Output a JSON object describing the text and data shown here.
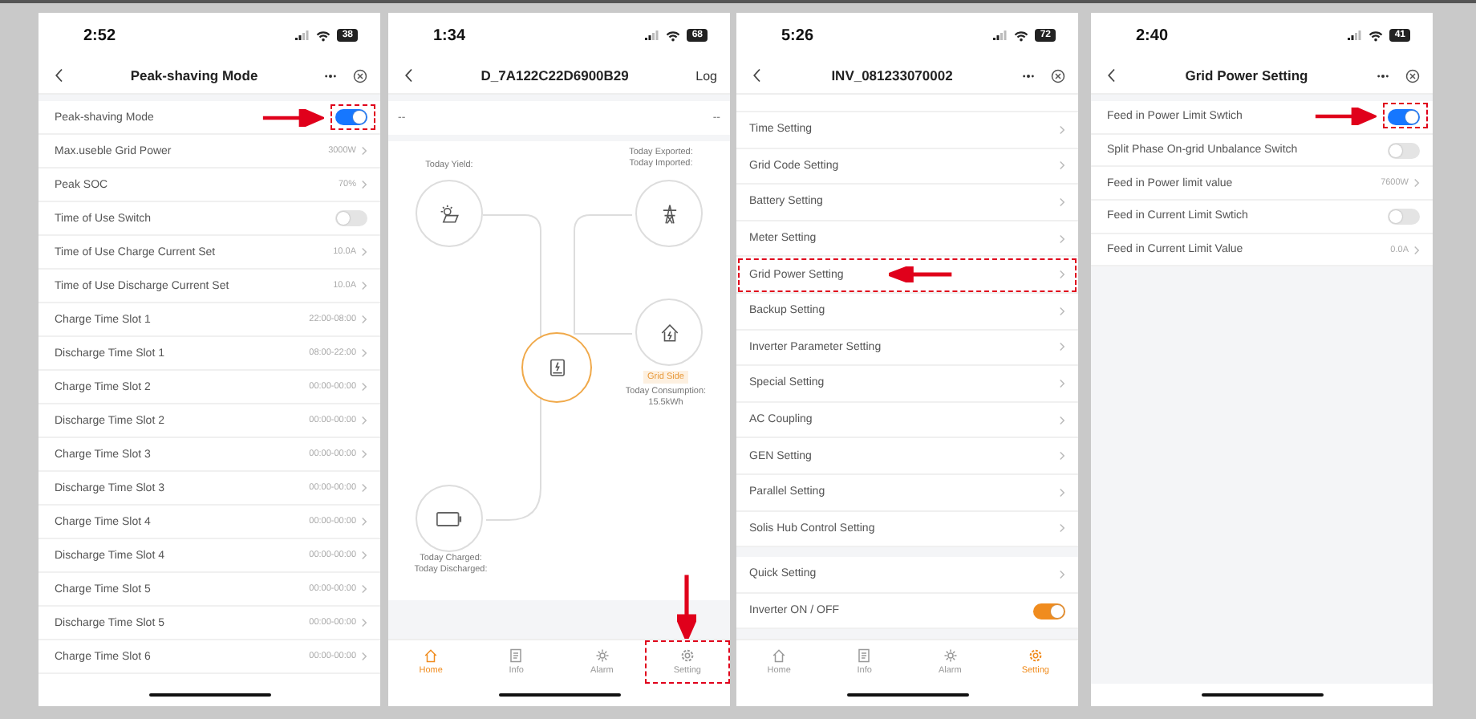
{
  "screens": [
    {
      "kind": "settings",
      "status": {
        "time": "2:52",
        "battery": "38"
      },
      "nav": {
        "title": "Peak-shaving Mode"
      },
      "groups": [
        {
          "rows": [
            {
              "kind": "toggle",
              "label": "Peak-shaving Mode",
              "on": true,
              "highlighted": true
            },
            {
              "kind": "value",
              "label": "Max.useble Grid Power",
              "value": "3000W",
              "highlighted": false
            },
            {
              "kind": "value",
              "label": "Peak SOC",
              "value": "70%",
              "highlighted": false
            },
            {
              "kind": "toggle",
              "label": "Time of Use Switch",
              "on": false,
              "highlighted": false
            },
            {
              "kind": "value",
              "label": "Time of Use Charge Current Set",
              "value": "10.0A",
              "highlighted": false
            },
            {
              "kind": "value",
              "label": "Time of Use Discharge Current Set",
              "value": "10.0A",
              "highlighted": false
            },
            {
              "kind": "value",
              "label": "Charge Time Slot 1",
              "value": "22:00-08:00",
              "highlighted": false
            },
            {
              "kind": "value",
              "label": "Discharge Time Slot 1",
              "value": "08:00-22:00",
              "highlighted": false
            },
            {
              "kind": "value",
              "label": "Charge Time Slot 2",
              "value": "00:00-00:00",
              "highlighted": false
            },
            {
              "kind": "value",
              "label": "Discharge Time Slot 2",
              "value": "00:00-00:00",
              "highlighted": false
            },
            {
              "kind": "value",
              "label": "Charge Time Slot 3",
              "value": "00:00-00:00",
              "highlighted": false
            },
            {
              "kind": "value",
              "label": "Discharge Time Slot 3",
              "value": "00:00-00:00",
              "highlighted": false
            },
            {
              "kind": "value",
              "label": "Charge Time Slot 4",
              "value": "00:00-00:00",
              "highlighted": false
            },
            {
              "kind": "value",
              "label": "Discharge Time Slot 4",
              "value": "00:00-00:00",
              "highlighted": false
            },
            {
              "kind": "value",
              "label": "Charge Time Slot 5",
              "value": "00:00-00:00",
              "highlighted": false
            },
            {
              "kind": "value",
              "label": "Discharge Time Slot 5",
              "value": "00:00-00:00",
              "highlighted": false
            },
            {
              "kind": "value",
              "label": "Charge Time Slot 6",
              "value": "00:00-00:00",
              "highlighted": false
            }
          ]
        }
      ]
    },
    {
      "kind": "home",
      "status": {
        "time": "1:34",
        "battery": "68"
      },
      "nav": {
        "title": "D_7A122C22D6900B29",
        "action": "Log"
      },
      "summary": {
        "left": "--",
        "right": "--"
      },
      "flow": {
        "solar": {
          "labels": [
            "Today Yield:"
          ]
        },
        "grid": {
          "labels": [
            "Today Exported:",
            "Today Imported:"
          ]
        },
        "load": {
          "badge": "Grid Side",
          "labels": [
            "Today Consumption:",
            "15.5kWh"
          ]
        },
        "battery": {
          "labels": [
            "Today Charged:",
            "Today Discharged:"
          ]
        }
      },
      "tabs": [
        {
          "label": "Home",
          "selected": true,
          "highlighted": false
        },
        {
          "label": "Info",
          "selected": false,
          "highlighted": false
        },
        {
          "label": "Alarm",
          "selected": false,
          "highlighted": false
        },
        {
          "label": "Setting",
          "selected": false,
          "highlighted": true
        }
      ]
    },
    {
      "kind": "menu",
      "status": {
        "time": "5:26",
        "battery": "72"
      },
      "nav": {
        "title": "INV_081233070002"
      },
      "groups": [
        {
          "rows": [
            {
              "kind": "link",
              "label": "Time Setting",
              "highlighted": false
            },
            {
              "kind": "link",
              "label": "Grid Code Setting",
              "highlighted": false
            },
            {
              "kind": "link",
              "label": "Battery Setting",
              "highlighted": false
            },
            {
              "kind": "link",
              "label": "Meter Setting",
              "highlighted": false
            },
            {
              "kind": "link",
              "label": "Grid Power Setting",
              "highlighted": true
            },
            {
              "kind": "link",
              "label": "Backup Setting",
              "highlighted": false
            },
            {
              "kind": "link",
              "label": "Inverter Parameter Setting",
              "highlighted": false
            },
            {
              "kind": "link",
              "label": "Special Setting",
              "highlighted": false
            },
            {
              "kind": "link",
              "label": "AC Coupling",
              "highlighted": false
            },
            {
              "kind": "link",
              "label": "GEN Setting",
              "highlighted": false
            },
            {
              "kind": "link",
              "label": "Parallel Setting",
              "highlighted": false
            },
            {
              "kind": "link",
              "label": "Solis Hub Control Setting",
              "highlighted": false
            }
          ]
        },
        {
          "rows": [
            {
              "kind": "link",
              "label": "Quick Setting",
              "highlighted": false
            },
            {
              "kind": "toggle",
              "label": "Inverter ON / OFF",
              "on": true,
              "highlighted": false
            }
          ]
        }
      ],
      "tabs": [
        {
          "label": "Home",
          "selected": false,
          "highlighted": false
        },
        {
          "label": "Info",
          "selected": false,
          "highlighted": false
        },
        {
          "label": "Alarm",
          "selected": false,
          "highlighted": false
        },
        {
          "label": "Setting",
          "selected": true,
          "highlighted": false
        }
      ]
    },
    {
      "kind": "settings",
      "status": {
        "time": "2:40",
        "battery": "41"
      },
      "nav": {
        "title": "Grid Power Setting"
      },
      "groups": [
        {
          "rows": [
            {
              "kind": "toggle",
              "label": "Feed in Power Limit Swtich",
              "on": true,
              "highlighted": true
            },
            {
              "kind": "toggle",
              "label": "Split Phase On-grid Unbalance Switch",
              "on": false,
              "highlighted": false
            },
            {
              "kind": "value",
              "label": "Feed in Power limit value",
              "value": "7600W",
              "highlighted": false
            },
            {
              "kind": "toggle",
              "label": "Feed in Current Limit Swtich",
              "on": false,
              "highlighted": false
            },
            {
              "kind": "value",
              "label": "Feed in Current Limit Value",
              "value": "0.0A",
              "highlighted": false
            }
          ]
        }
      ]
    }
  ]
}
